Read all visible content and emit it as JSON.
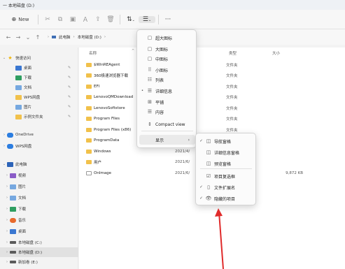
{
  "window": {
    "title": "一 本地磁盘 (D:)"
  },
  "toolbar": {
    "new_label": "New",
    "icons": [
      "cut-icon",
      "copy-icon",
      "paste-icon",
      "rename-icon",
      "share-icon",
      "delete-icon",
      "sort-icon",
      "view-icon",
      "more-icon"
    ],
    "sort_glyph": "⇅",
    "view_glyph": "☰",
    "more_glyph": "···"
  },
  "address": {
    "back": "←",
    "forward": "→",
    "recent": "⌄",
    "up": "↑",
    "segments": [
      "此电脑",
      "›",
      "本地磁盘 (D:)",
      "›"
    ]
  },
  "sidebar": {
    "items": [
      {
        "label": "快速访问",
        "chev": "⌄",
        "icon": "star",
        "pinned": false
      },
      {
        "label": "桌面",
        "chev": "",
        "icon": "blue",
        "pinned": true
      },
      {
        "label": "下载",
        "chev": "",
        "icon": "green",
        "pinned": true
      },
      {
        "label": "文档",
        "chev": "",
        "icon": "lightblue",
        "pinned": true
      },
      {
        "label": "WPS网盘",
        "chev": "",
        "icon": "folder",
        "pinned": true
      },
      {
        "label": "图片",
        "chev": "",
        "icon": "lightblue",
        "pinned": true
      },
      {
        "label": "示例文件夹",
        "chev": "",
        "icon": "folder",
        "pinned": true
      },
      {
        "label": "OneDrive",
        "chev": "›",
        "icon": "cloud",
        "pinned": false
      },
      {
        "label": "WPS网盘",
        "chev": "›",
        "icon": "cloud",
        "pinned": false
      },
      {
        "label": "此电脑",
        "chev": "⌄",
        "icon": "pcblue",
        "pinned": false
      },
      {
        "label": "视频",
        "chev": "›",
        "icon": "purple",
        "pinned": false
      },
      {
        "label": "图片",
        "chev": "›",
        "icon": "lightblue",
        "pinned": false
      },
      {
        "label": "文档",
        "chev": "›",
        "icon": "lightblue",
        "pinned": false
      },
      {
        "label": "下载",
        "chev": "›",
        "icon": "green",
        "pinned": false
      },
      {
        "label": "音乐",
        "chev": "›",
        "icon": "orange",
        "pinned": false
      },
      {
        "label": "桌面",
        "chev": "›",
        "icon": "blue",
        "pinned": false
      },
      {
        "label": "本地磁盘 (C:)",
        "chev": "›",
        "icon": "drive",
        "pinned": false
      },
      {
        "label": "本地磁盘 (D:)",
        "chev": "›",
        "icon": "drive",
        "pinned": false,
        "selected": true
      },
      {
        "label": "新加卷 (E:)",
        "chev": "›",
        "icon": "drive",
        "pinned": false
      }
    ],
    "pin_glyph": "📌"
  },
  "filelist": {
    "headers": {
      "name": "名称",
      "type": "类型",
      "size": "大小"
    },
    "sort_caret": "^",
    "rows": [
      {
        "name": "$WinREAgent",
        "date": "2:15",
        "type": "文件夹",
        "size": "",
        "kind": "folder"
      },
      {
        "name": "360极速浏览器下载",
        "date": "3 17:26",
        "type": "文件夹",
        "size": "",
        "kind": "folder"
      },
      {
        "name": "EFI",
        "date": "3 17:18",
        "type": "文件夹",
        "size": "",
        "kind": "folder"
      },
      {
        "name": "LenovoQMDownload",
        "date": "6 19:40",
        "type": "文件夹",
        "size": "",
        "kind": "folder"
      },
      {
        "name": "LenovoSoftstore",
        "date": "6 23:31",
        "type": "文件夹",
        "size": "",
        "kind": "folder"
      },
      {
        "name": "Program Files",
        "date": "2:41",
        "type": "文件夹",
        "size": "",
        "kind": "folder"
      },
      {
        "name": "Program Files (x86)",
        "date": "6 15:00",
        "type": "文件夹",
        "size": "",
        "kind": "folder"
      },
      {
        "name": "ProgramData",
        "date": "",
        "type": "",
        "size": "",
        "kind": "folder"
      },
      {
        "name": "Windows",
        "date": "2021/4/",
        "type": "",
        "size": "",
        "kind": "folder"
      },
      {
        "name": "用户",
        "date": "2021/6/",
        "type": "",
        "size": "",
        "kind": "folder"
      },
      {
        "name": "OnImage",
        "date": "2021/6/",
        "type": "",
        "size": "9,872 KB",
        "kind": "file"
      }
    ]
  },
  "view_menu": {
    "items": [
      {
        "label": "超大图标",
        "glyph": "▢",
        "check": ""
      },
      {
        "label": "大图标",
        "glyph": "▢",
        "check": ""
      },
      {
        "label": "中图标",
        "glyph": "▢",
        "check": ""
      },
      {
        "label": "小图标",
        "glyph": "⠿",
        "check": ""
      },
      {
        "label": "列表",
        "glyph": "☷",
        "check": ""
      },
      {
        "label": "详细信息",
        "glyph": "☰",
        "check": "•"
      },
      {
        "label": "平铺",
        "glyph": "⊞",
        "check": ""
      },
      {
        "label": "内容",
        "glyph": "☰",
        "check": ""
      },
      {
        "label": "Compact view",
        "glyph": "⇕",
        "check": ""
      }
    ],
    "show": {
      "label": "显示",
      "arrow": "›"
    }
  },
  "show_submenu": {
    "items": [
      {
        "label": "导航窗格",
        "glyph": "◫",
        "check": "✓"
      },
      {
        "label": "详细信息窗格",
        "glyph": "◫",
        "check": ""
      },
      {
        "label": "预览窗格",
        "glyph": "◫",
        "check": ""
      },
      {
        "label": "项目复选框",
        "glyph": "☑",
        "check": ""
      },
      {
        "label": "文件扩展名",
        "glyph": "▯",
        "check": "✓"
      },
      {
        "label": "隐藏的项目",
        "glyph": "👁",
        "check": "✓"
      }
    ]
  },
  "colors": {
    "arrow": "#e02b2b",
    "accent": "#3a77d1",
    "folder": "#f1c14b"
  }
}
